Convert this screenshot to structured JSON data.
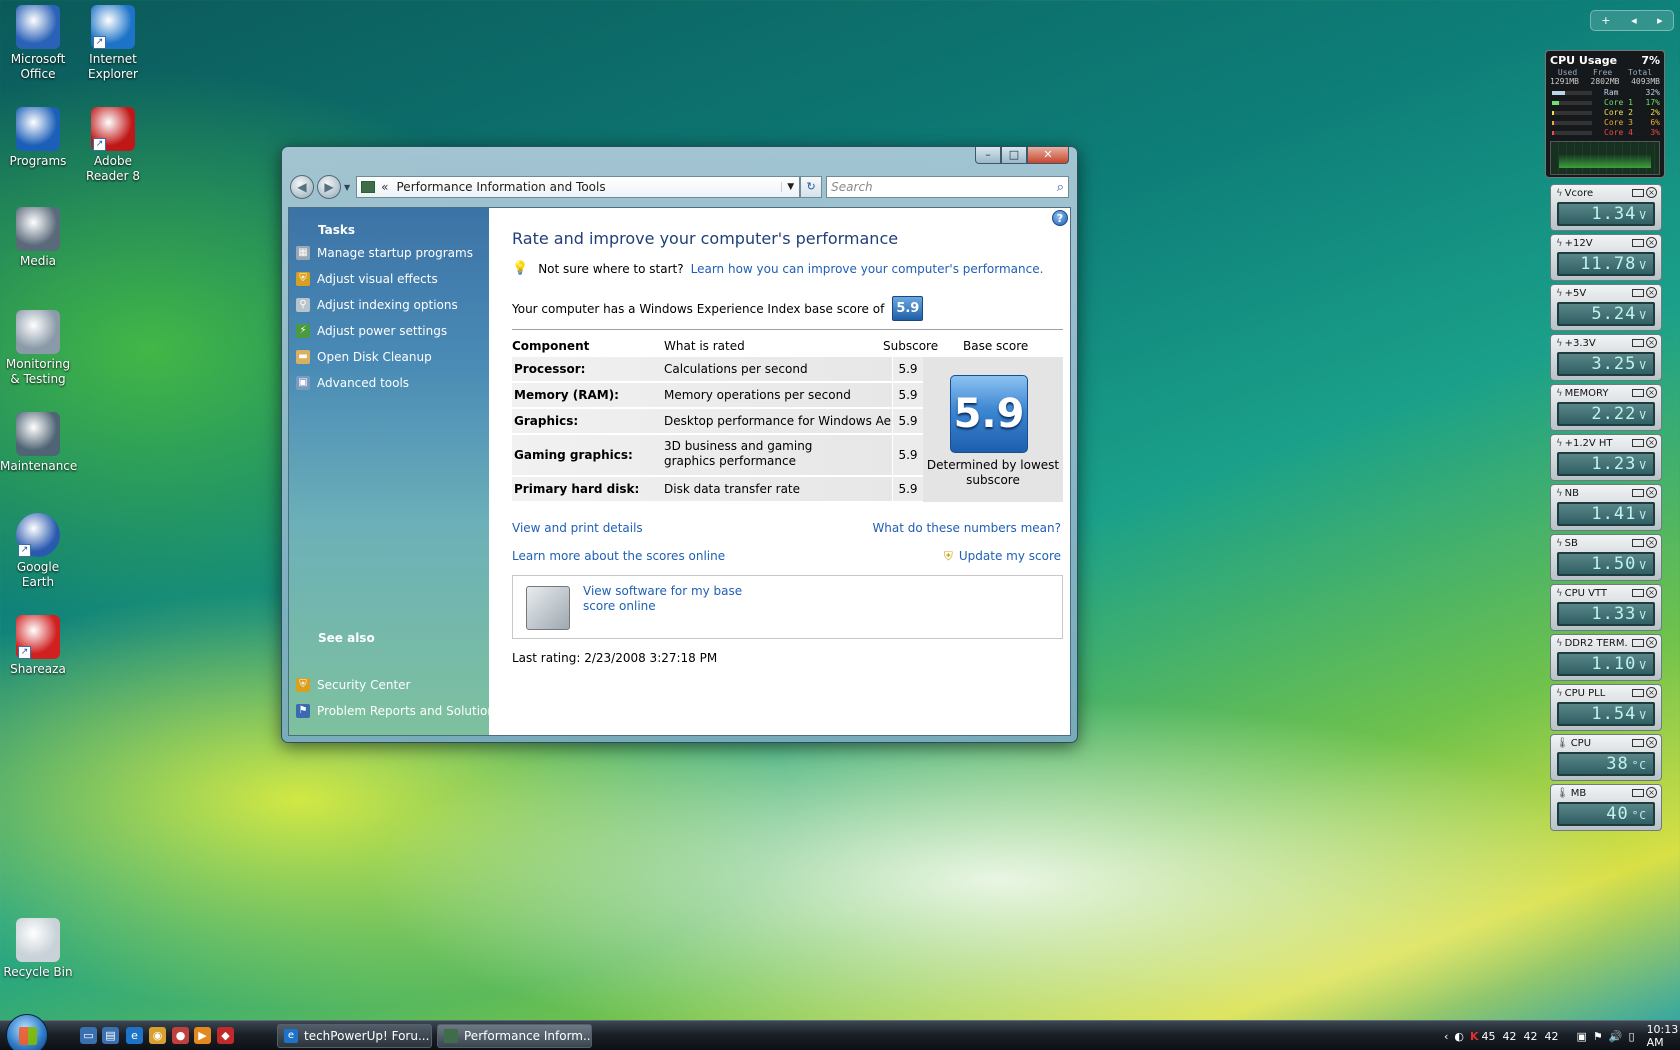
{
  "desktop_icons": [
    {
      "label": "Microsoft Office",
      "icon": "office-icon",
      "shortcut": false
    },
    {
      "label": "Internet Explorer",
      "icon": "ie-icon",
      "shortcut": true
    },
    {
      "label": "Programs",
      "icon": "programs-icon",
      "shortcut": false
    },
    {
      "label": "Adobe Reader 8",
      "icon": "pdf-icon",
      "shortcut": true
    },
    {
      "label": "Media",
      "icon": "media-icon",
      "shortcut": false
    },
    {
      "label": "Monitoring & Testing",
      "icon": "magnifier-icon",
      "shortcut": false
    },
    {
      "label": "Maintenance",
      "icon": "maintenance-icon",
      "shortcut": false
    },
    {
      "label": "Google Earth",
      "icon": "globe-icon",
      "shortcut": true
    },
    {
      "label": "Shareaza",
      "icon": "shareaza-icon",
      "shortcut": true
    },
    {
      "label": "Recycle Bin",
      "icon": "recycle-bin-icon",
      "shortcut": false
    }
  ],
  "window": {
    "address": "Performance Information and Tools",
    "address_chevron": "«",
    "search_placeholder": "Search",
    "caption": {
      "min": "–",
      "max": "□",
      "close": "✕"
    }
  },
  "left_pane": {
    "tasks_heading": "Tasks",
    "tasks": [
      "Manage startup programs",
      "Adjust visual effects",
      "Adjust indexing options",
      "Adjust power settings",
      "Open Disk Cleanup",
      "Advanced tools"
    ],
    "see_also_heading": "See also",
    "see_also": [
      "Security Center",
      "Problem Reports and Solutions"
    ]
  },
  "main": {
    "title": "Rate and improve your computer's performance",
    "tip_prefix": "Not sure where to start?",
    "tip_link": "Learn how you can improve your computer's performance.",
    "wei_text": "Your computer has a Windows Experience Index base score of",
    "base_score": "5.9",
    "columns": {
      "component": "Component",
      "rated": "What is rated",
      "subscore": "Subscore",
      "base": "Base score"
    },
    "rows": [
      {
        "component": "Processor:",
        "rated": "Calculations per second",
        "subscore": "5.9"
      },
      {
        "component": "Memory (RAM):",
        "rated": "Memory operations per second",
        "subscore": "5.9"
      },
      {
        "component": "Graphics:",
        "rated": "Desktop performance for Windows Aero",
        "subscore": "5.9"
      },
      {
        "component": "Gaming graphics:",
        "rated": "3D business and gaming graphics performance",
        "subscore": "5.9"
      },
      {
        "component": "Primary hard disk:",
        "rated": "Disk data transfer rate",
        "subscore": "5.9"
      }
    ],
    "base_caption": "Determined by lowest subscore",
    "links": {
      "view_print": "View and print details",
      "what_numbers": "What do these numbers mean?",
      "learn_more": "Learn more about the scores online",
      "update": "Update my score",
      "software": "View software for my base score online"
    },
    "last_rating": "Last rating: 2/23/2008 3:27:18 PM"
  },
  "cpu_gadget": {
    "title": "CPU Usage",
    "percent": "7%",
    "mem_headers": [
      "Used",
      "Free",
      "Total"
    ],
    "mem_values": [
      "1291MB",
      "2802MB",
      "4093MB"
    ],
    "meters": [
      {
        "label": "Ram",
        "value": "32%",
        "color": "#bcd4ea",
        "fill": 0.32
      },
      {
        "label": "Core 1",
        "value": "17%",
        "color": "#6fe06f",
        "fill": 0.17
      },
      {
        "label": "Core 2",
        "value": "2%",
        "color": "#f2e04a",
        "fill": 0.02
      },
      {
        "label": "Core 3",
        "value": "6%",
        "color": "#f5a83a",
        "fill": 0.06
      },
      {
        "label": "Core 4",
        "value": "3%",
        "color": "#f04a4a",
        "fill": 0.03
      }
    ]
  },
  "voltage_gadgets": [
    {
      "label": "Vcore",
      "value": "1.34",
      "unit": "V"
    },
    {
      "label": "+12V",
      "value": "11.78",
      "unit": "V"
    },
    {
      "label": "+5V",
      "value": "5.24",
      "unit": "V"
    },
    {
      "label": "+3.3V",
      "value": "3.25",
      "unit": "V"
    },
    {
      "label": "MEMORY",
      "value": "2.22",
      "unit": "V"
    },
    {
      "label": "+1.2V HT",
      "value": "1.23",
      "unit": "V"
    },
    {
      "label": "NB",
      "value": "1.41",
      "unit": "V"
    },
    {
      "label": "SB",
      "value": "1.50",
      "unit": "V"
    },
    {
      "label": "CPU VTT",
      "value": "1.33",
      "unit": "V"
    },
    {
      "label": "DDR2 TERM.",
      "value": "1.10",
      "unit": "V"
    },
    {
      "label": "CPU PLL",
      "value": "1.54",
      "unit": "V"
    },
    {
      "label": "CPU",
      "value": "38",
      "unit": "°C"
    },
    {
      "label": "MB",
      "value": "40",
      "unit": "°C"
    }
  ],
  "taskbar": {
    "buttons": [
      "techPowerUp! Foru...",
      "Performance Inform..."
    ],
    "tray_temps": "45  42  42  42",
    "clock": "10:13 AM"
  }
}
